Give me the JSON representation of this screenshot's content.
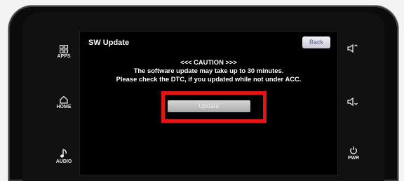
{
  "screen": {
    "title": "SW Update",
    "back_label": "Back",
    "caution_heading": "<<< CAUTION >>>",
    "caution_line1": "The software update may take up to 30 minutes.",
    "caution_line2": "Please check the DTC, if you updated while not under ACC.",
    "update_label": "Update"
  },
  "side_buttons": {
    "apps": "APPS",
    "home": "HOME",
    "audio": "AUDIO",
    "pwr": "PWR"
  },
  "colors": {
    "highlight": "#e2141a",
    "screen_bg": "#000000"
  }
}
